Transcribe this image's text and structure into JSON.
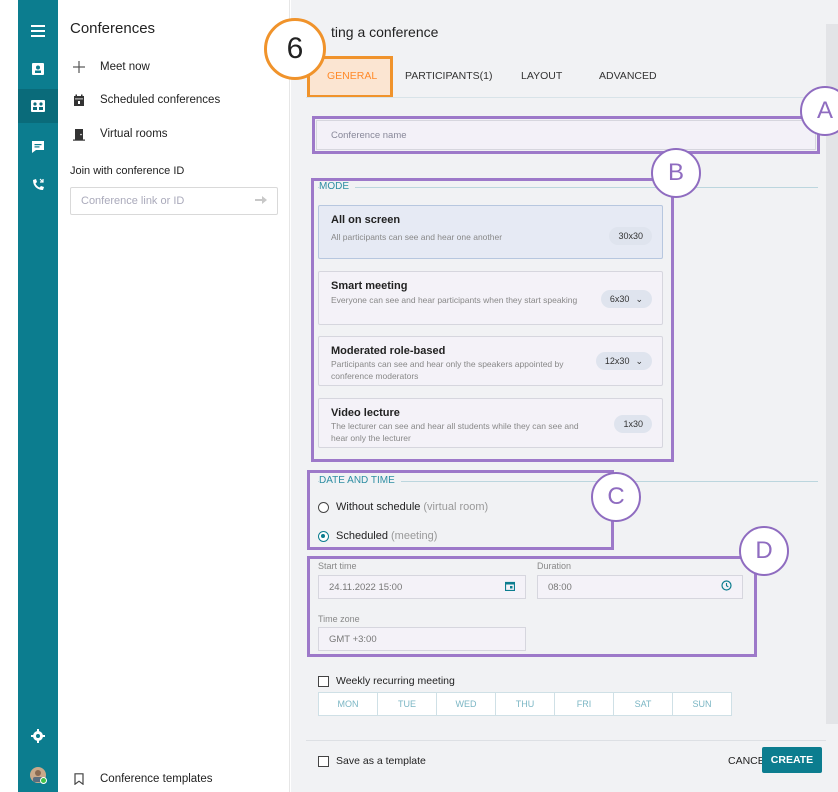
{
  "sidebar": {
    "title": "Conferences",
    "items": [
      {
        "label": "Meet now",
        "icon": "plus-icon"
      },
      {
        "label": "Scheduled conferences",
        "icon": "calendar-icon"
      },
      {
        "label": "Virtual rooms",
        "icon": "door-icon"
      }
    ],
    "join_label": "Join with conference ID",
    "join_placeholder": "Conference link or ID",
    "templates_label": "Conference templates"
  },
  "main": {
    "title": "ting a conference",
    "tabs": [
      {
        "label": "GENERAL",
        "active": true
      },
      {
        "label": "PARTICIPANTS(1)",
        "active": false
      },
      {
        "label": "LAYOUT",
        "active": false
      },
      {
        "label": "ADVANCED",
        "active": false
      }
    ],
    "conference_name_placeholder": "Conference name",
    "mode_label": "MODE",
    "modes": [
      {
        "title": "All on screen",
        "desc": "All participants can see and hear one another",
        "size": "30x30",
        "selected": true,
        "dropdown": false
      },
      {
        "title": "Smart meeting",
        "desc": "Everyone can see and hear participants when they start speaking",
        "size": "6x30",
        "selected": false,
        "dropdown": true
      },
      {
        "title": "Moderated role-based",
        "desc": "Participants can see and hear only the speakers appointed by conference moderators",
        "size": "12x30",
        "selected": false,
        "dropdown": true
      },
      {
        "title": "Video lecture",
        "desc": "The lecturer can see and hear all students while they can see and hear only the lecturer",
        "size": "1x30",
        "selected": false,
        "dropdown": false
      }
    ],
    "datetime_label": "DATE AND TIME",
    "schedule_options": [
      {
        "label": "Without schedule",
        "note": "(virtual room)",
        "selected": false
      },
      {
        "label": "Scheduled",
        "note": "(meeting)",
        "selected": true
      }
    ],
    "start_time_label": "Start time",
    "start_time_value": "24.11.2022 15:00",
    "duration_label": "Duration",
    "duration_value": "08:00",
    "timezone_label": "Time zone",
    "timezone_value": "GMT +3:00",
    "weekly_label": "Weekly recurring meeting",
    "days": [
      "MON",
      "TUE",
      "WED",
      "THU",
      "FRI",
      "SAT",
      "SUN"
    ],
    "save_template_label": "Save as a template",
    "cancel_label": "CANCEL",
    "create_label": "CREATE"
  },
  "annotations": {
    "step": "6",
    "a": "A",
    "b": "B",
    "c": "C",
    "d": "D"
  },
  "colors": {
    "accent": "#0c7d8f",
    "annotation_purple": "#9d79c9",
    "annotation_orange": "#f0932b",
    "active_tab": "#ff8a2a"
  }
}
